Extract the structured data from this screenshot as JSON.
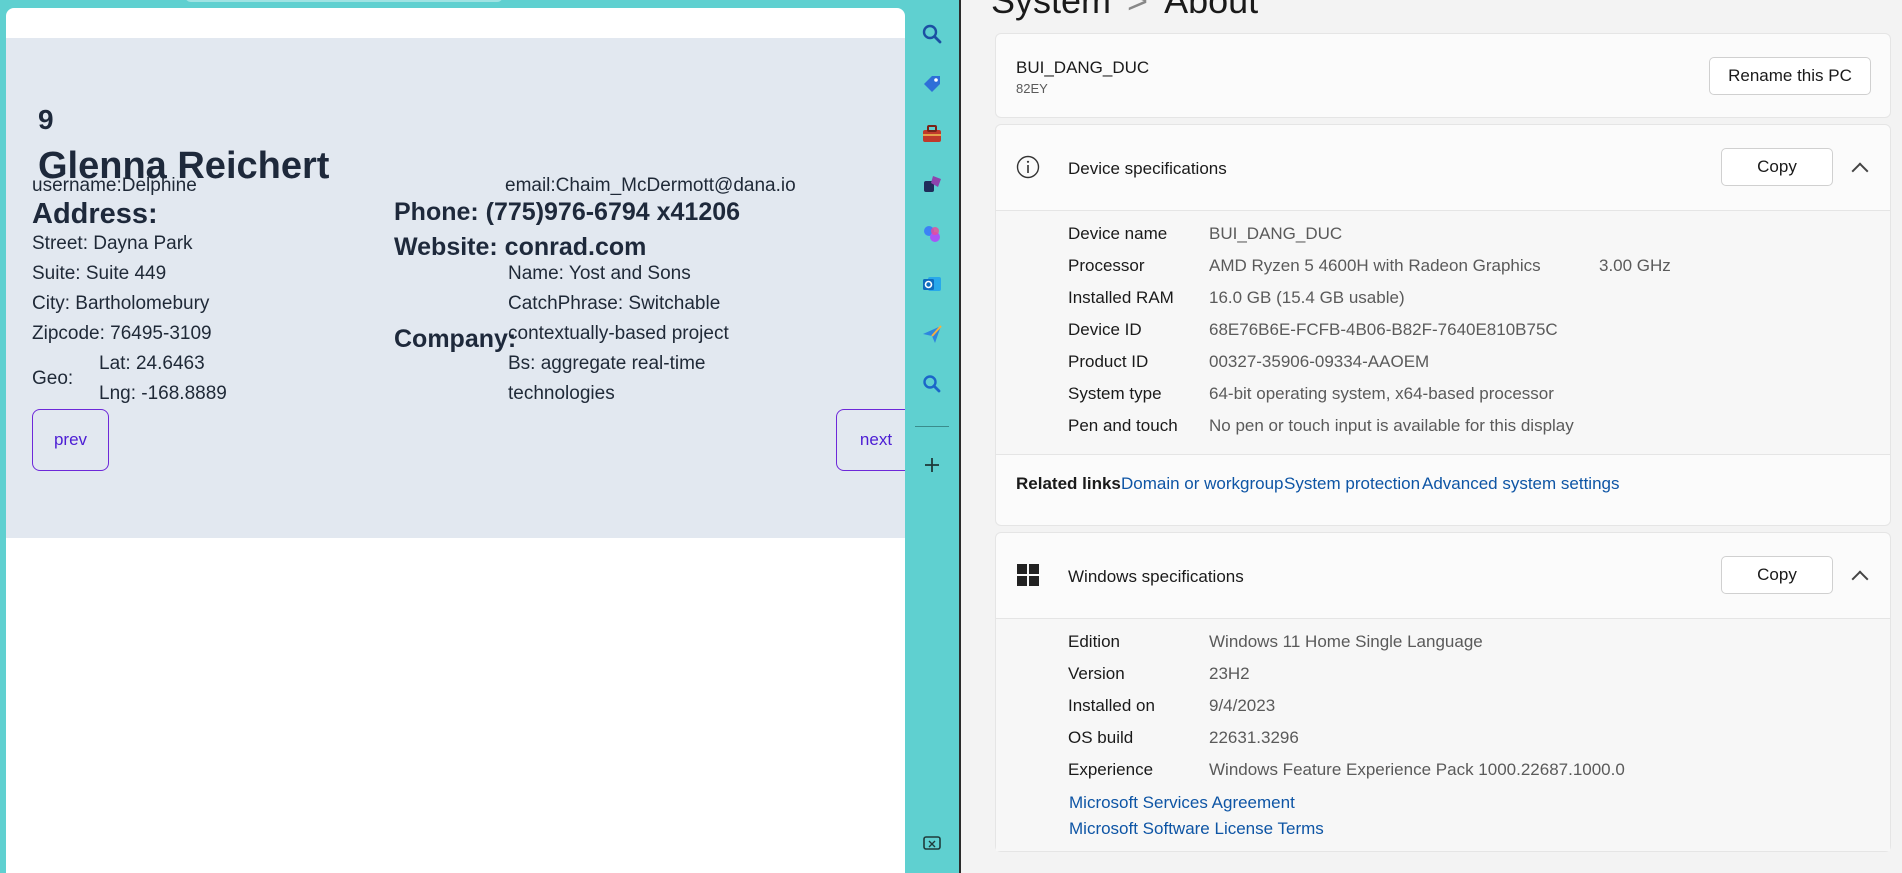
{
  "user_card": {
    "id": "9",
    "name": "Glenna Reichert",
    "username": "username:Delphine",
    "email": "email:Chaim_McDermott@dana.io",
    "address_heading": "Address:",
    "street": "Street: Dayna Park",
    "suite": "Suite: Suite 449",
    "city": "City: Bartholomebury",
    "zipcode": "Zipcode: 76495-3109",
    "geo_label": "Geo:",
    "lat": "Lat: 24.6463",
    "lng": "Lng: -168.8889",
    "phone": "Phone: (775)976-6794 x41206",
    "website": "Website: conrad.com",
    "company_heading": "Company:",
    "company_name": "Name: Yost and Sons",
    "catchphrase_1": "CatchPhrase: Switchable",
    "catchphrase_2": "contextually-based project",
    "bs_1": "Bs: aggregate real-time",
    "bs_2": "technologies",
    "prev_label": "prev",
    "next_label": "next"
  },
  "sidebar": {
    "icons": [
      "search-icon",
      "tag-icon",
      "toolbox-icon",
      "games-icon",
      "copilot-icon",
      "outlook-icon",
      "send-icon",
      "bing-search-icon",
      "add-icon",
      "screenshot-icon"
    ]
  },
  "settings": {
    "title_part1": "System",
    "title_separator": ">",
    "title_part2": "About",
    "pc_name": "BUI_DANG_DUC",
    "pc_model": "82EY",
    "rename_label": "Rename this PC",
    "device_spec_title": "Device specifications",
    "copy_label": "Copy",
    "device_specs": [
      {
        "label": "Device name",
        "value": "BUI_DANG_DUC"
      },
      {
        "label": "Processor",
        "value": "AMD Ryzen 5 4600H with Radeon Graphics",
        "extra": "3.00 GHz"
      },
      {
        "label": "Installed RAM",
        "value": "16.0 GB (15.4 GB usable)"
      },
      {
        "label": "Device ID",
        "value": "68E76B6E-FCFB-4B06-B82F-7640E810B75C"
      },
      {
        "label": "Product ID",
        "value": "00327-35906-09334-AAOEM"
      },
      {
        "label": "System type",
        "value": "64-bit operating system, x64-based processor"
      },
      {
        "label": "Pen and touch",
        "value": "No pen or touch input is available for this display"
      }
    ],
    "related_links_label": "Related links",
    "related_links": [
      "Domain or workgroup",
      "System protection",
      "Advanced system settings"
    ],
    "windows_spec_title": "Windows specifications",
    "windows_specs": [
      {
        "label": "Edition",
        "value": "Windows 11 Home Single Language"
      },
      {
        "label": "Version",
        "value": "23H2"
      },
      {
        "label": "Installed on",
        "value": "9/4/2023"
      },
      {
        "label": "OS build",
        "value": "22631.3296"
      },
      {
        "label": "Experience",
        "value": "Windows Feature Experience Pack 1000.22687.1000.0"
      }
    ],
    "license_links": [
      "Microsoft Services Agreement",
      "Microsoft Software License Terms"
    ]
  },
  "colors": {
    "teal_background": "#5fd0d0",
    "card_background": "#e2e8f0",
    "button_border": "#6d28d9",
    "link_blue": "#0e55a5"
  }
}
